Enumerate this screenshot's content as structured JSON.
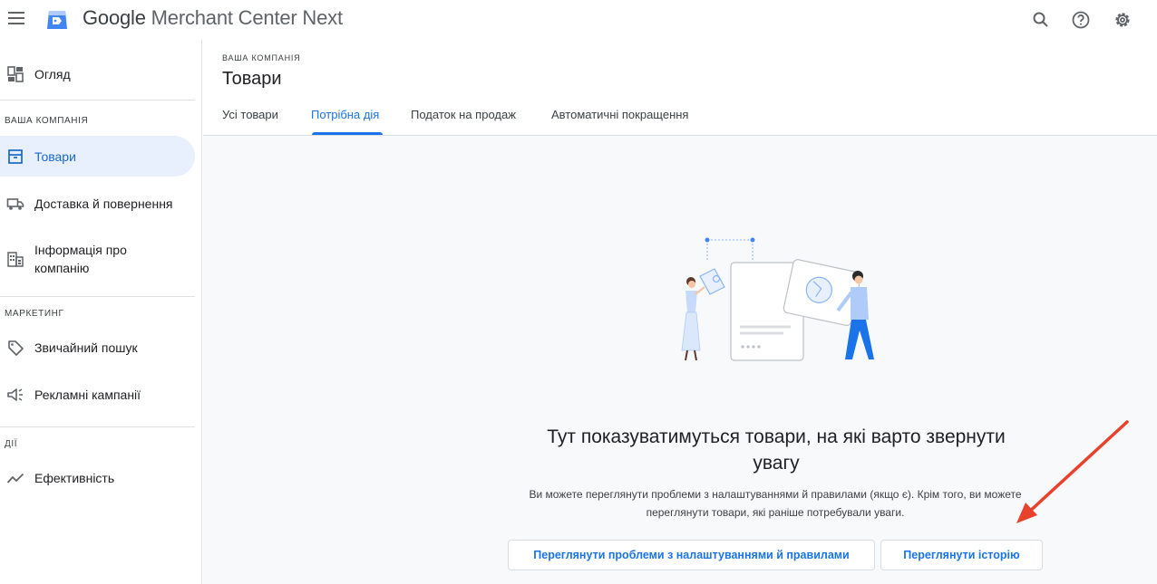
{
  "app": {
    "title_brand": "Google",
    "title_rest": " Merchant Center Next"
  },
  "topbar": {
    "icons": [
      "menu-icon",
      "merchant-center-logo",
      "search-icon",
      "help-icon",
      "settings-icon"
    ]
  },
  "sidebar": {
    "overview_label": "Огляд",
    "sections": [
      {
        "label": "ВАША КОМПАНІЯ"
      },
      {
        "label": "МАРКЕТИНГ"
      },
      {
        "label": "ДІЇ"
      }
    ],
    "items": [
      {
        "label": "Товари",
        "icon": "products-icon"
      },
      {
        "label": "Доставка й повернення",
        "icon": "truck-icon"
      },
      {
        "label": "Інформація про компанію",
        "icon": "building-icon"
      },
      {
        "label": "Звичайний пошук",
        "icon": "tag-icon"
      },
      {
        "label": "Рекламні кампанії",
        "icon": "megaphone-icon"
      },
      {
        "label": "Ефективність",
        "icon": "trending-icon"
      }
    ]
  },
  "header": {
    "overline": "ВАША КОМПАНІЯ",
    "title": "Товари",
    "tabs": [
      {
        "label": "Усі товари"
      },
      {
        "label": "Потрібна дія"
      },
      {
        "label": "Податок на продаж"
      },
      {
        "label": "Автоматичні покращення"
      }
    ],
    "active_tab": "Потрібна дія"
  },
  "empty_state": {
    "headline": "Тут показуватимуться товари, на які варто звернути увагу",
    "description": "Ви можете переглянути проблеми з налаштуваннями й правилами (якщо є). Крім того, ви можете переглянути товари, які раніше потребували уваги.",
    "primary_button": "Переглянути проблеми з налаштуваннями й правилами",
    "history_button": "Переглянути історію"
  },
  "colors": {
    "accent": "#1a73e8",
    "active_bg": "#e8f0fe",
    "annotation_arrow": "#e8412c"
  }
}
